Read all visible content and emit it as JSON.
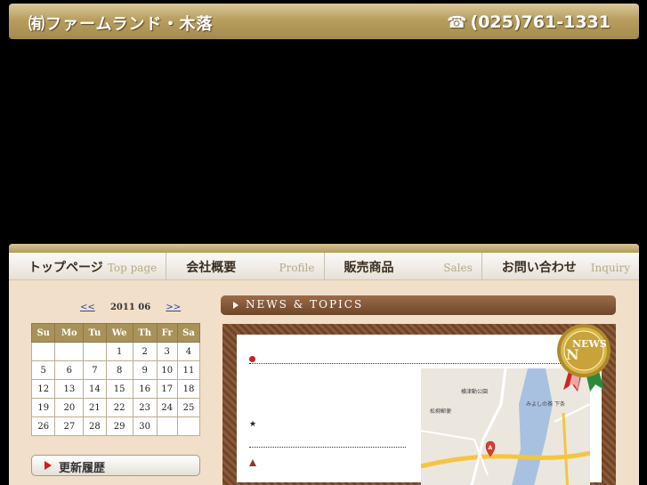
{
  "header": {
    "brand": "㈲ファームランド・木落",
    "phone_icon": "telephone-icon",
    "phone": "(025)761-1331"
  },
  "nav": [
    {
      "ja": "トップページ",
      "en": "Top page"
    },
    {
      "ja": "会社概要",
      "en": "Profile"
    },
    {
      "ja": "販売商品",
      "en": "Sales"
    },
    {
      "ja": "お問い合わせ",
      "en": "Inquiry"
    }
  ],
  "calendar": {
    "prev": "<<",
    "next": ">>",
    "month": "2011 06",
    "days": [
      "Su",
      "Mo",
      "Tu",
      "We",
      "Th",
      "Fr",
      "Sa"
    ],
    "weeks": [
      [
        "",
        "",
        "",
        "1",
        "2",
        "3",
        "4"
      ],
      [
        "5",
        "6",
        "7",
        "8",
        "9",
        "10",
        "11"
      ],
      [
        "12",
        "13",
        "14",
        "15",
        "16",
        "17",
        "18"
      ],
      [
        "19",
        "20",
        "21",
        "22",
        "23",
        "24",
        "25"
      ],
      [
        "26",
        "27",
        "28",
        "29",
        "30",
        "",
        ""
      ]
    ]
  },
  "history_button": "更新履歴",
  "news": {
    "title": "NEWS & TOPICS",
    "badge_text": "NEWS",
    "star": "★"
  },
  "map": {
    "labels": [
      "横津動公園",
      "松柳郵便",
      "下条",
      "みよしの茶"
    ]
  },
  "colors": {
    "gold": "#b89e5e",
    "brown": "#6e4629",
    "beige": "#f1dfc9",
    "accent_red": "#cc1f1f"
  }
}
